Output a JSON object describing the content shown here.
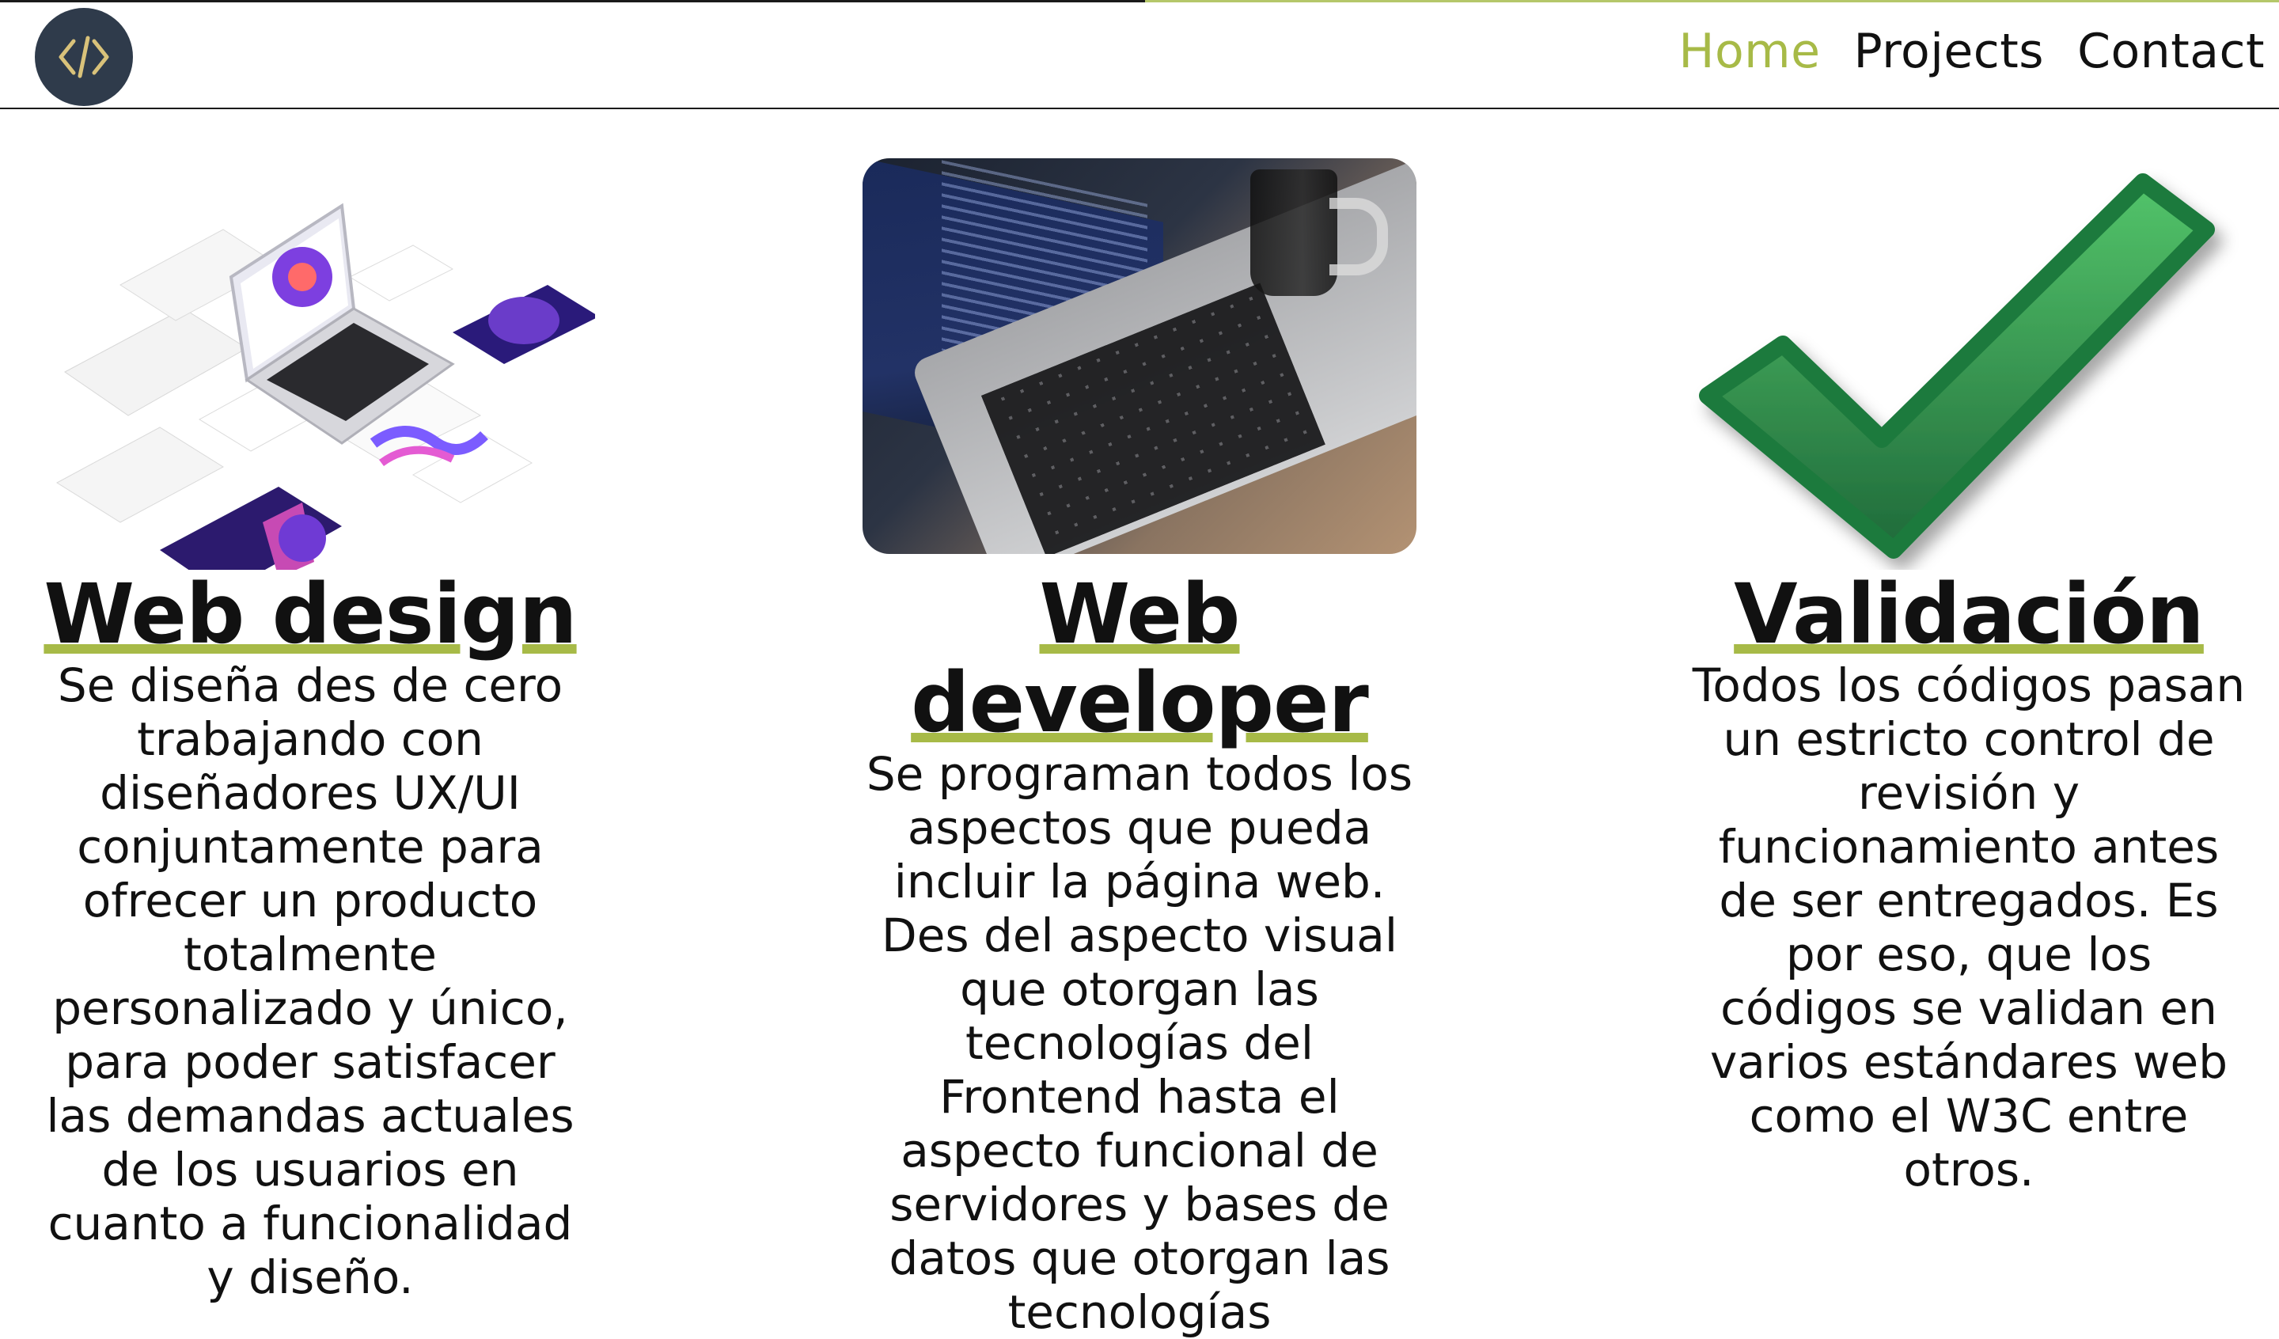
{
  "header": {
    "logo_icon": "code-brackets-icon",
    "nav": [
      {
        "label": "Home",
        "active": true
      },
      {
        "label": "Projects",
        "active": false
      },
      {
        "label": "Contact",
        "active": false
      }
    ]
  },
  "colors": {
    "accent": "#a7ba47",
    "logo_bg": "#2f3b4b",
    "logo_fg": "#d9c27a"
  },
  "sections": [
    {
      "title": "Web design",
      "image": "web-design-mockups-illustration",
      "description": "Se diseña des de cero trabajando con diseñadores UX/UI conjuntamente para ofrecer un producto totalmente personalizado y único, para poder satisfacer las demandas actuales de los usuarios en cuanto a funcionalidad y diseño."
    },
    {
      "title": "Web developer",
      "image": "laptop-code-photo",
      "description": "Se programan todos los aspectos que pueda incluir la página web. Des del aspecto visual que otorgan las tecnologías del Frontend hasta el aspecto funcional de servidores y bases de datos que otorgan las tecnologías"
    },
    {
      "title": "Validación",
      "image": "green-checkmark-icon",
      "description": "Todos los códigos pasan un estricto control de revisión y funcionamiento antes de ser entregados. Es por eso, que los códigos se validan en varios estándares web como el W3C entre otros."
    }
  ]
}
